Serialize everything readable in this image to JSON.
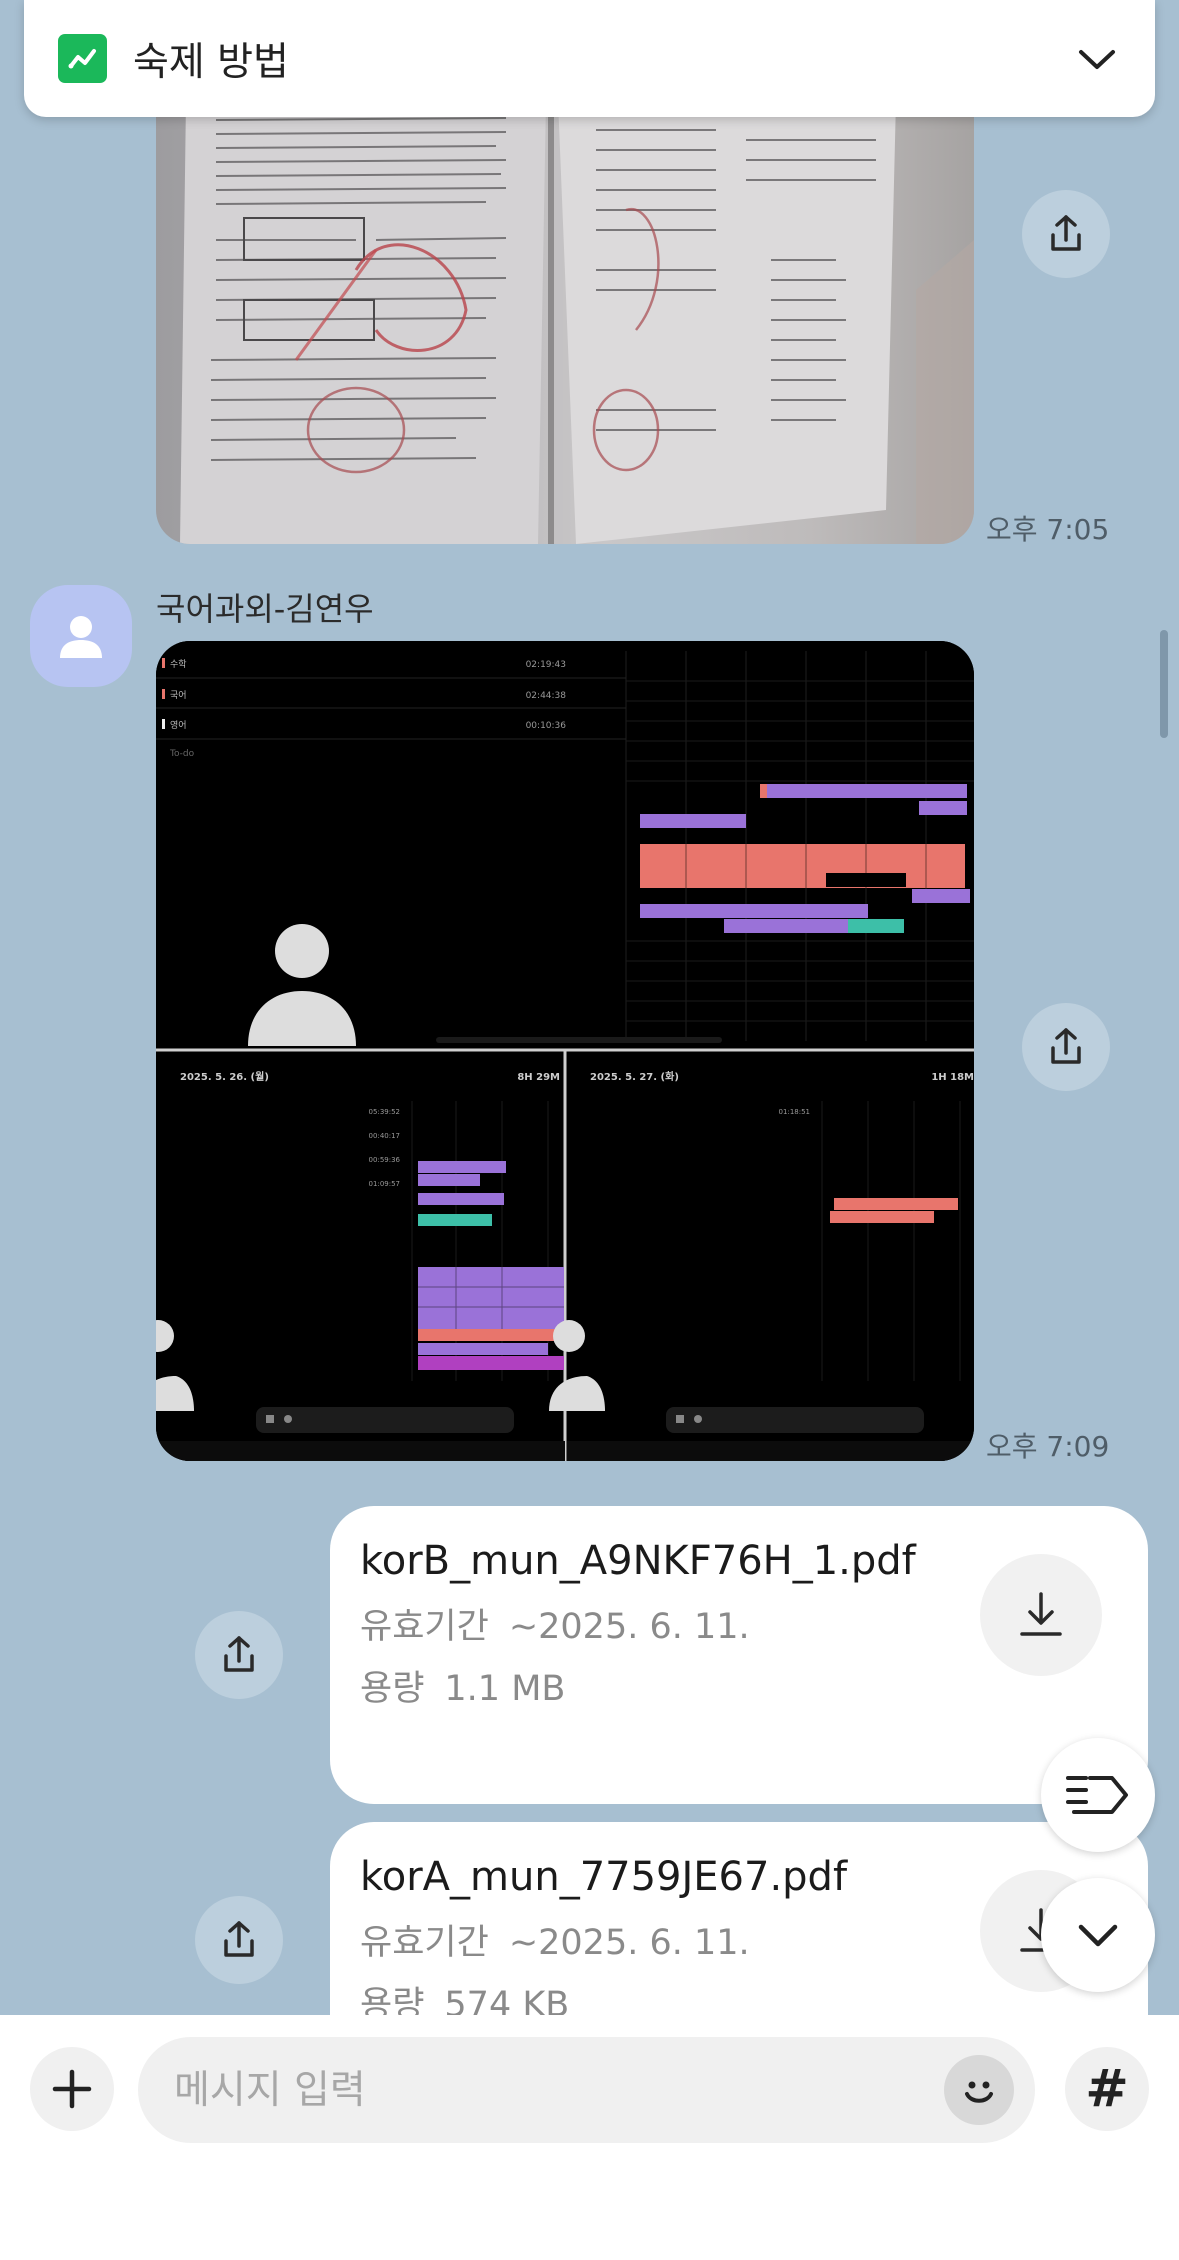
{
  "notice": {
    "title": "숙제 방법",
    "icon": "chart-icon",
    "accent": "#1bb85a"
  },
  "messages": [
    {
      "type": "image",
      "description_icon": "photo",
      "time": "오후 7:05"
    },
    {
      "type": "image",
      "sender": "국어과외-김연우",
      "time": "오후 7:09",
      "screenshot_labels": {
        "top_rows": [
          "수학",
          "국어",
          "영어"
        ],
        "top_times": [
          "02:19:43",
          "02:44:38",
          "00:10:36"
        ],
        "todo": "To-do",
        "left_date": "2025. 5. 26. (월)",
        "left_total": "8H 29M",
        "left_times": [
          "05:39:52",
          "00:40:17",
          "00:59:36",
          "01:09:57"
        ],
        "right_date": "2025. 5. 27. (화)",
        "right_total": "1H 18M",
        "right_times": [
          "01:18:51"
        ]
      }
    },
    {
      "type": "file",
      "filename": "korB_mun_A9NKF76H_1.pdf",
      "expiry_label": "유효기간",
      "expiry_value": "~2025. 6. 11.",
      "size_label": "용량",
      "size_value": "1.1 MB"
    },
    {
      "type": "file",
      "filename": "korA_mun_7759JE67.pdf",
      "expiry_label": "유효기간",
      "expiry_value": "~2025. 6. 11.",
      "size_label": "용량",
      "size_value": "574 KB"
    }
  ],
  "composer": {
    "placeholder": "메시지 입력",
    "hash_label": "#"
  },
  "colors": {
    "chat_background": "#a7bfd1",
    "bar_purple": "#9a72d8",
    "bar_salmon": "#e8756c",
    "bar_teal": "#3dbfa8",
    "bar_magenta": "#b040c0"
  }
}
